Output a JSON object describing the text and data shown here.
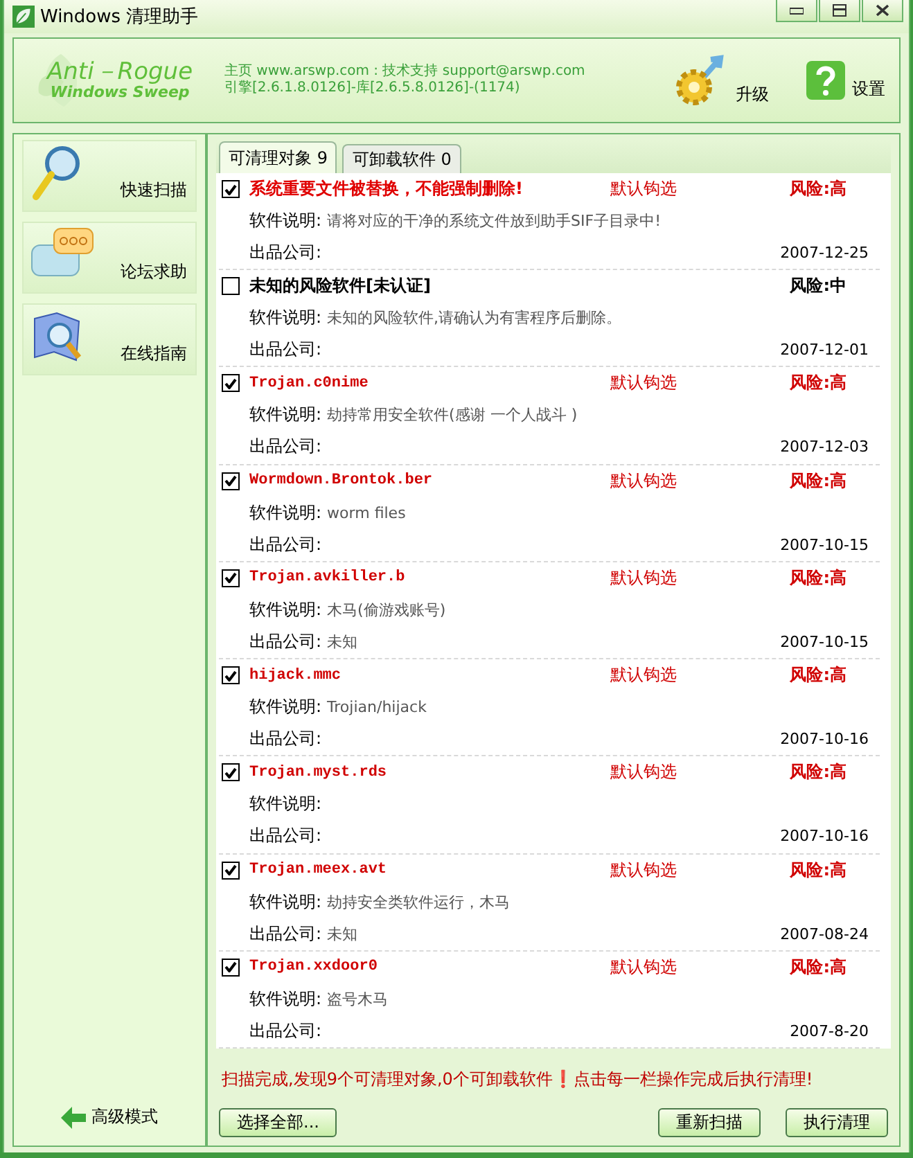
{
  "window": {
    "title": "Windows 清理助手"
  },
  "header": {
    "logo_line1": "Anti－Rogue",
    "logo_line2": "Windows Sweep",
    "info_line1": "主页 www.arswp.com : 技术支持 support@arswp.com",
    "info_line2": "引擎[2.6.1.8.0126]-库[2.6.5.8.0126]-(1174)",
    "actions": [
      {
        "kind": "upgrade",
        "label": "升级"
      },
      {
        "kind": "settings",
        "label": "设置"
      }
    ]
  },
  "sidebar": {
    "items": [
      {
        "kind": "scan",
        "label": "快速扫描"
      },
      {
        "kind": "forum",
        "label": "论坛求助"
      },
      {
        "kind": "guide",
        "label": "在线指南"
      }
    ],
    "advanced": "高级模式"
  },
  "tabs": [
    {
      "label": "可清理对象 9",
      "selected": true
    },
    {
      "label": "可卸载软件 0",
      "selected": false
    }
  ],
  "items": [
    {
      "kind": "system",
      "checked": true,
      "name": "系统重要文件被替换，不能强制删除!",
      "tag": "默认钩选",
      "risk": "风险:高",
      "high_risk": true,
      "desc_label": "软件说明:",
      "desc": "请将对应的干净的系统文件放到助手SIF子目录中!",
      "company_label": "出品公司:",
      "date": "2007-12-25"
    },
    {
      "kind": "unknown",
      "checked": false,
      "name": "未知的风险软件[未认证]",
      "risk": "风险:中",
      "high_risk": false,
      "desc_label": "软件说明:",
      "desc": "未知的风险软件,请确认为有害程序后删除。",
      "company_label": "出品公司:",
      "date": "2007-12-01"
    },
    {
      "kind": "threat",
      "checked": true,
      "name": "Trojan.c0nime",
      "tag": "默认钩选",
      "risk": "风险:高",
      "high_risk": true,
      "desc_label": "软件说明:",
      "desc": "劫持常用安全软件(感谢 一个人战斗 )",
      "company_label": "出品公司:",
      "date": "2007-12-03"
    },
    {
      "kind": "threat",
      "checked": true,
      "name": "Wormdown.Brontok.ber",
      "tag": "默认钩选",
      "risk": "风险:高",
      "high_risk": true,
      "desc_label": "软件说明:",
      "desc": "worm files",
      "company_label": "出品公司:",
      "date": "2007-10-15"
    },
    {
      "kind": "threat",
      "checked": true,
      "name": "Trojan.avkiller.b",
      "tag": "默认钩选",
      "risk": "风险:高",
      "high_risk": true,
      "desc_label": "软件说明:",
      "desc": "木马(偷游戏账号)",
      "company_label": "出品公司:",
      "company": "未知",
      "date": "2007-10-15"
    },
    {
      "kind": "threat",
      "checked": true,
      "name": "hijack.mmc",
      "tag": "默认钩选",
      "risk": "风险:高",
      "high_risk": true,
      "desc_label": "软件说明:",
      "desc": "Trojian/hijack",
      "company_label": "出品公司:",
      "date": "2007-10-16"
    },
    {
      "kind": "threat",
      "checked": true,
      "name": "Trojan.myst.rds",
      "tag": "默认钩选",
      "risk": "风险:高",
      "high_risk": true,
      "desc_label": "软件说明:",
      "company_label": "出品公司:",
      "date": "2007-10-16"
    },
    {
      "kind": "threat",
      "checked": true,
      "name": "Trojan.meex.avt",
      "tag": "默认钩选",
      "risk": "风险:高",
      "high_risk": true,
      "desc_label": "软件说明:",
      "desc": "劫持安全类软件运行，木马",
      "company_label": "出品公司:",
      "company": "未知",
      "date": "2007-08-24"
    },
    {
      "kind": "threat",
      "checked": true,
      "name": "Trojan.xxdoor0",
      "tag": "默认钩选",
      "risk": "风险:高",
      "high_risk": true,
      "desc_label": "软件说明:",
      "desc": "盗号木马",
      "company_label": "出品公司:",
      "date": "2007-8-20"
    }
  ],
  "status_message": "扫描完成,发现9个可清理对象,0个可卸载软件❗点击每一栏操作完成后执行清理!",
  "buttons": {
    "left": [
      "选择全部..."
    ],
    "right": [
      "重新扫描",
      "执行清理"
    ]
  }
}
